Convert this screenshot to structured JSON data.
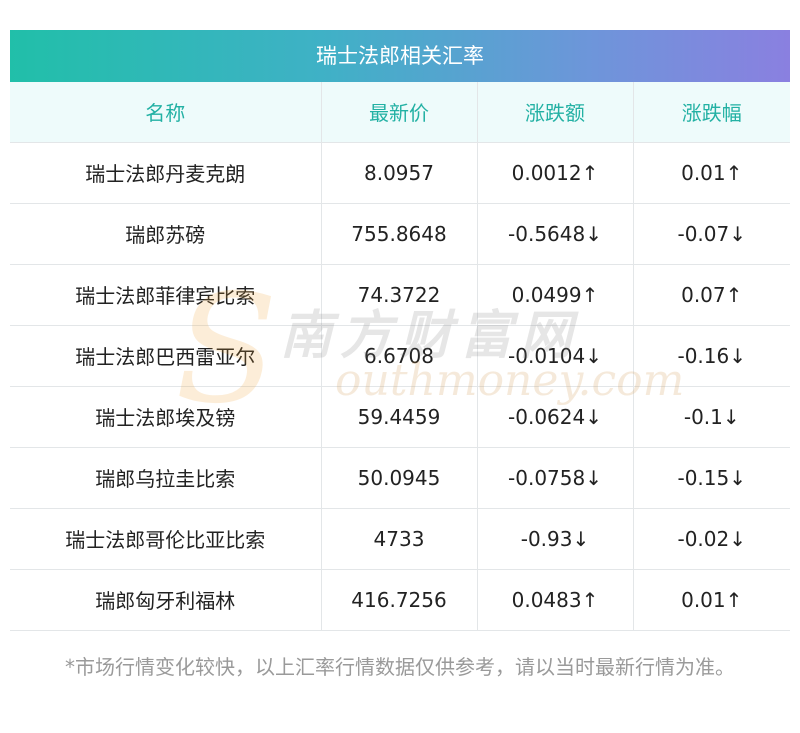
{
  "title": "瑞士法郎相关汇率",
  "columns": [
    "名称",
    "最新价",
    "涨跌额",
    "涨跌幅"
  ],
  "rows": [
    {
      "name": "瑞士法郎丹麦克朗",
      "price": "8.0957",
      "change": "0.0012↑",
      "pct": "0.01↑",
      "dir": "up"
    },
    {
      "name": "瑞郎苏磅",
      "price": "755.8648",
      "change": "-0.5648↓",
      "pct": "-0.07↓",
      "dir": "down"
    },
    {
      "name": "瑞士法郎菲律宾比索",
      "price": "74.3722",
      "change": "0.0499↑",
      "pct": "0.07↑",
      "dir": "up"
    },
    {
      "name": "瑞士法郎巴西雷亚尔",
      "price": "6.6708",
      "change": "-0.0104↓",
      "pct": "-0.16↓",
      "dir": "down"
    },
    {
      "name": "瑞士法郎埃及镑",
      "price": "59.4459",
      "change": "-0.0624↓",
      "pct": "-0.1↓",
      "dir": "down"
    },
    {
      "name": "瑞郎乌拉圭比索",
      "price": "50.0945",
      "change": "-0.0758↓",
      "pct": "-0.15↓",
      "dir": "down"
    },
    {
      "name": "瑞士法郎哥伦比亚比索",
      "price": "4733",
      "change": "-0.93↓",
      "pct": "-0.02↓",
      "dir": "down"
    },
    {
      "name": "瑞郎匈牙利福林",
      "price": "416.7256",
      "change": "0.0483↑",
      "pct": "0.01↑",
      "dir": "up"
    }
  ],
  "note": "*市场行情变化较快，以上汇率行情数据仅供参考，请以当时最新行情为准。",
  "watermark": {
    "cn": "南方财富网",
    "en": "outhmoney.com",
    "letter": "S"
  },
  "colors": {
    "up": "#e60012",
    "down": "#1a8a2c",
    "header_text": "#23b1a4"
  }
}
